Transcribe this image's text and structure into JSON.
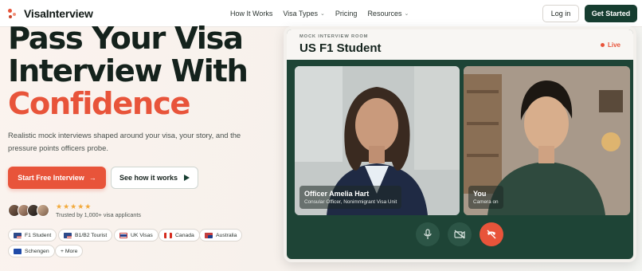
{
  "brand": {
    "name": "VisaInterview"
  },
  "nav": {
    "links": [
      {
        "label": "How It Works",
        "dropdown": false
      },
      {
        "label": "Visa Types",
        "dropdown": true
      },
      {
        "label": "Pricing",
        "dropdown": false
      },
      {
        "label": "Resources",
        "dropdown": true
      }
    ],
    "login_label": "Log in",
    "get_started_label": "Get Started"
  },
  "hero": {
    "title_line1": "Pass Your Visa",
    "title_line2": "Interview With",
    "title_accent": "Confidence",
    "subtitle": "Realistic mock interviews shaped around your visa, your story, and the pressure points officers probe.",
    "cta_primary": "Start Free Interview",
    "cta_primary_icon": "arrow-right-icon",
    "cta_secondary": "See how it works",
    "cta_secondary_icon": "play-icon",
    "rating_stars": 5,
    "stars_text": "★★★★★",
    "trusted_text": "Trusted by 1,000+ visa applicants"
  },
  "visa_chips": [
    {
      "label": "F1 Student",
      "flag": "us"
    },
    {
      "label": "B1/B2 Tourist",
      "flag": "us"
    },
    {
      "label": "UK Visas",
      "flag": "uk"
    },
    {
      "label": "Canada",
      "flag": "ca"
    },
    {
      "label": "Australia",
      "flag": "au"
    },
    {
      "label": "Schengen",
      "flag": "eu"
    },
    {
      "label": "+ More",
      "flag": ""
    }
  ],
  "room": {
    "kicker": "MOCK INTERVIEW ROOM",
    "title": "US F1 Student",
    "live_label": "Live",
    "officer": {
      "name": "Officer Amelia Hart",
      "role": "Consular Officer, Nonimmigrant Visa Unit"
    },
    "you": {
      "name": "You",
      "status": "Camera on"
    },
    "controls": [
      "microphone-icon",
      "camera-off-icon",
      "end-call-icon"
    ]
  },
  "colors": {
    "accent": "#e8543a",
    "brand_dark": "#163d30",
    "room_bg": "#1e4436",
    "star": "#f2a93b"
  }
}
